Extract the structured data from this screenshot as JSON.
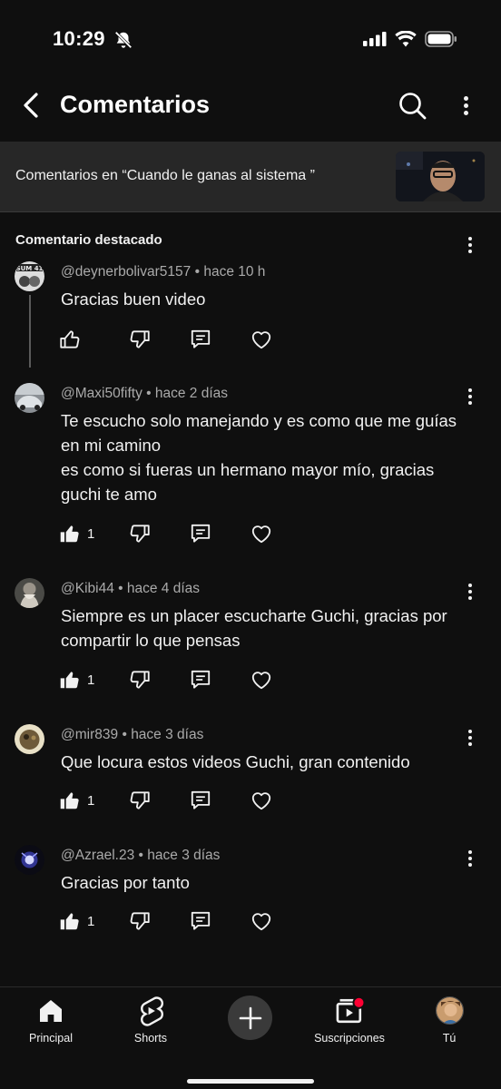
{
  "status_bar": {
    "time": "10:29"
  },
  "header": {
    "title": "Comentarios"
  },
  "video_banner": {
    "text": "Comentarios en “Cuando le ganas al sistema ”"
  },
  "pinned": {
    "label": "Comentario destacado"
  },
  "comments": [
    {
      "handle": "@deynerbolivar5157",
      "time": "hace 10 h",
      "text": "Gracias buen video",
      "likes": ""
    },
    {
      "handle": "@Maxi50fifty",
      "time": "hace 2 días",
      "text": "Te escucho solo manejando y es como que me guías en mi camino\nes como si fueras un hermano mayor mío, gracias guchi te amo",
      "likes": "1"
    },
    {
      "handle": "@Kibi44",
      "time": "hace 4 días",
      "text": "Siempre es un placer escucharte Guchi, gracias por compartir lo que pensas",
      "likes": "1"
    },
    {
      "handle": "@mir839",
      "time": "hace 3 días",
      "text": "Que locura estos videos Guchi, gran contenido",
      "likes": "1"
    },
    {
      "handle": "@Azrael.23",
      "time": "hace 3 días",
      "text": "Gracias por tanto",
      "likes": "1"
    }
  ],
  "meta_separator": "•",
  "bottom_nav": {
    "home": "Principal",
    "shorts": "Shorts",
    "subscriptions": "Suscripciones",
    "you": "Tú"
  },
  "colors": {
    "background": "#0f0f0f",
    "banner": "#272727",
    "meta": "#aaaaaa",
    "notification": "#ff0033"
  }
}
